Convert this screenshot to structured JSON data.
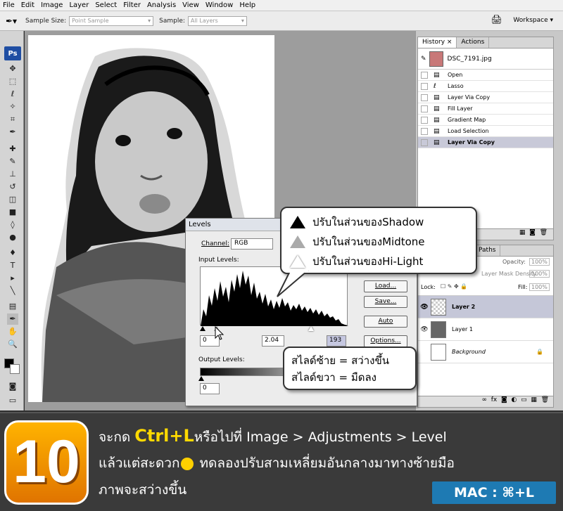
{
  "menu": [
    "File",
    "Edit",
    "Image",
    "Layer",
    "Select",
    "Filter",
    "Analysis",
    "View",
    "Window",
    "Help"
  ],
  "options_bar": {
    "sample_size_label": "Sample Size:",
    "sample_size_value": "Point Sample",
    "sample_label": "Sample:",
    "sample_value": "All Layers",
    "workspace_label": "Workspace ▾"
  },
  "toolbox": {
    "logo": "Ps"
  },
  "history": {
    "tabs": [
      "History ×",
      "Actions"
    ],
    "snapshot": "DSC_7191.jpg",
    "items": [
      "Open",
      "Lasso",
      "Layer Via Copy",
      "Fill Layer",
      "Gradient Map",
      "Load Selection",
      "Layer Via Copy"
    ]
  },
  "layers": {
    "tab": "Paths",
    "opacity_label": "Opacity:",
    "opacity_value": "100%",
    "density_label": "Layer Mask Density",
    "lock_label": "Lock:",
    "fill_label": "Fill:",
    "fill_value": "100%",
    "rows": [
      "Layer 2",
      "Layer 1",
      "Background"
    ]
  },
  "levels": {
    "title": "Levels",
    "channel_label": "Channel:",
    "channel_value": "RGB",
    "input_label": "Input Levels:",
    "input_black": "0",
    "input_mid": "2.04",
    "input_white": "193",
    "output_label": "Output Levels:",
    "output_black": "0",
    "buttons": [
      "Load...",
      "Save...",
      "Auto",
      "Options..."
    ]
  },
  "callout_top": {
    "lines": [
      "ปรับในส่วนของShadow",
      "ปรับในส่วนของMidtone",
      "ปรับในส่วนของHi-Light"
    ]
  },
  "callout_bottom": {
    "line1": "สไลด์ซ้าย  =  สว่างขึ้น",
    "line2": "สไลด์ขวา  =   มืดลง"
  },
  "banner": {
    "step": "10",
    "line1_pre": "จะกด ",
    "line1_key": "Ctrl+L",
    "line1_post": "หรือไปที่ Image > Adjustments > Level",
    "line2_pre": "แล้วแต่สะดวก",
    "line2_post": " ทดลองปรับสามเหลี่ยมอันกลางมาทางซ้ายมือ",
    "line3": "ภาพจะสว่างขึ้น",
    "mac_label": "MAC :  ⌘+L"
  }
}
